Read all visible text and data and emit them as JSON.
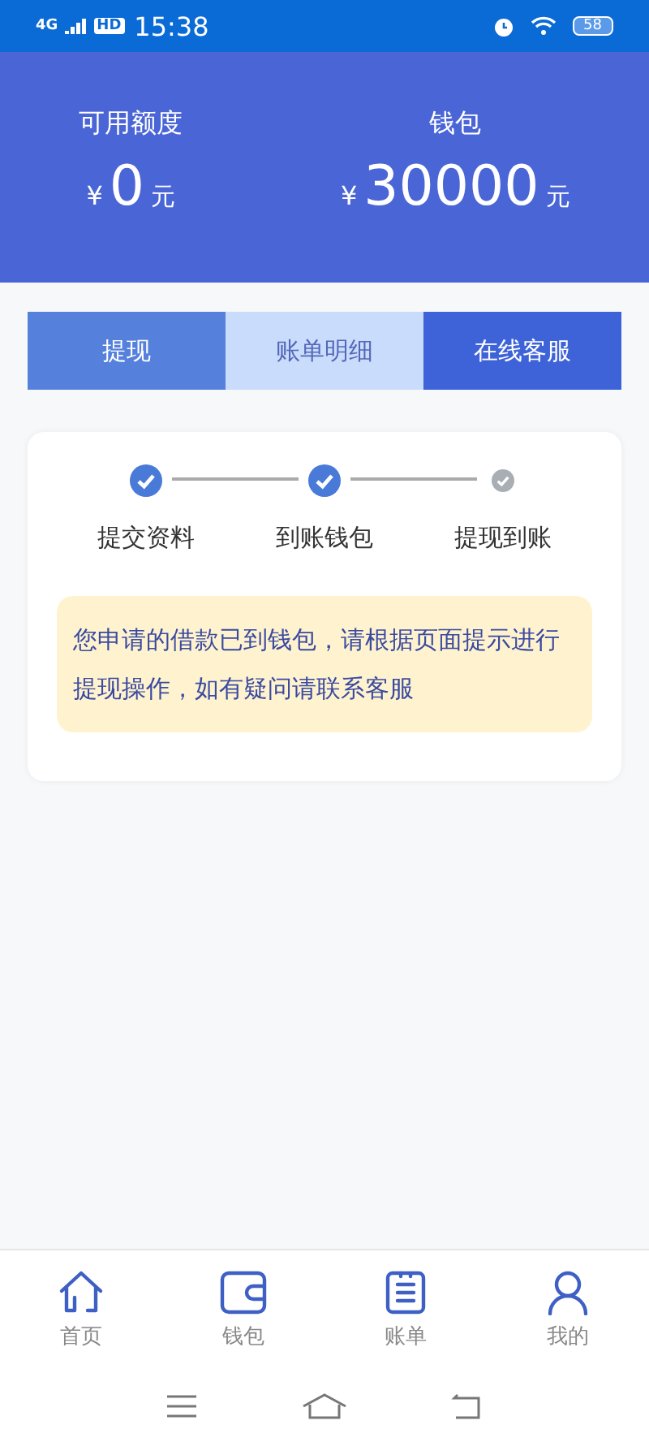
{
  "status_bar": {
    "network": "4G",
    "hd": "HD",
    "time": "15:38",
    "battery": "58"
  },
  "header": {
    "items": [
      {
        "label": "可用额度",
        "currency": "¥",
        "amount": "0",
        "unit": "元"
      },
      {
        "label": "钱包",
        "currency": "¥",
        "amount": "30000",
        "unit": "元"
      }
    ]
  },
  "actions": [
    {
      "label": "提现",
      "kind": "medium"
    },
    {
      "label": "账单明细",
      "kind": "light"
    },
    {
      "label": "在线客服",
      "kind": "dark"
    }
  ],
  "progress": {
    "steps": [
      {
        "label": "提交资料",
        "done": true
      },
      {
        "label": "到账钱包",
        "done": true
      },
      {
        "label": "提现到账",
        "done": false
      }
    ],
    "notice": "您申请的借款已到钱包，请根据页面提示进行提现操作，如有疑问请联系客服"
  },
  "tab_bar": [
    {
      "label": "首页",
      "kind": "home"
    },
    {
      "label": "钱包",
      "kind": "wallet"
    },
    {
      "label": "账单",
      "kind": "bill"
    },
    {
      "label": "我的",
      "kind": "user"
    }
  ]
}
